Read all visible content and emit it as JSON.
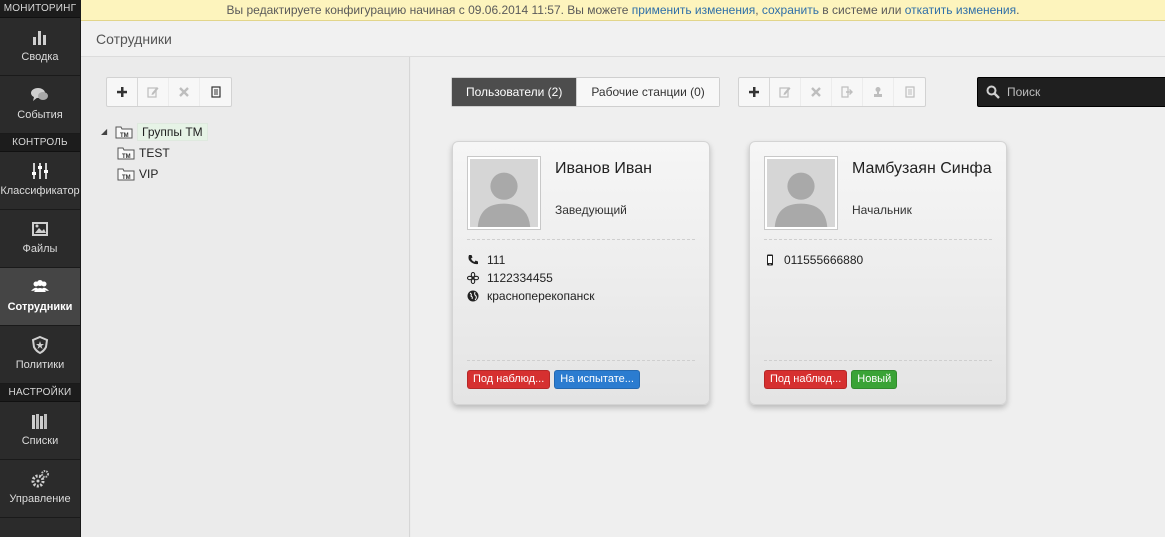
{
  "notice": {
    "text_before": "Вы редактируете конфигурацию начиная с 09.06.2014 11:57. Вы можете ",
    "apply_link": "применить изменения",
    "text_mid1": ", ",
    "save_link": "сохранить",
    "text_mid2": " в системе или ",
    "revert_link": "откатить изменения",
    "text_end": "."
  },
  "page_title": "Сотрудники",
  "nav": {
    "section_monitoring": "МОНИТОРИНГ",
    "section_control": "КОНТРОЛЬ",
    "section_settings": "НАСТРОЙКИ",
    "items": [
      {
        "label": "Сводка",
        "icon": "bar-chart-icon"
      },
      {
        "label": "События",
        "icon": "chat-bubbles-icon"
      },
      {
        "label": "Классификатор",
        "icon": "sliders-icon"
      },
      {
        "label": "Файлы",
        "icon": "images-icon"
      },
      {
        "label": "Сотрудники",
        "icon": "users-icon"
      },
      {
        "label": "Политики",
        "icon": "shield-star-icon"
      },
      {
        "label": "Списки",
        "icon": "books-icon"
      },
      {
        "label": "Управление",
        "icon": "gears-icon"
      }
    ]
  },
  "tree": {
    "root": "Группы ТМ",
    "children": [
      "TEST",
      "VIP"
    ]
  },
  "tabs": {
    "users": "Пользователи (2)",
    "workstations": "Рабочие станции (0)"
  },
  "search": {
    "placeholder": "Поиск"
  },
  "cards": [
    {
      "name": "Иванов Иван",
      "role": "Заведующий",
      "contacts": [
        {
          "type": "phone-icon",
          "value": "111"
        },
        {
          "type": "icq-flower-icon",
          "value": "1122334455"
        },
        {
          "type": "globe-icon",
          "value": "красноперекопанск"
        }
      ],
      "badges": [
        {
          "label": "Под наблюд...",
          "color": "#d63030"
        },
        {
          "label": "На испытате...",
          "color": "#2b7cd0"
        }
      ]
    },
    {
      "name": "Мамбузаян Синфа",
      "role": "Начальник",
      "contacts": [
        {
          "type": "mobile-phone-icon",
          "value": "011555666880"
        }
      ],
      "badges": [
        {
          "label": "Под наблюд...",
          "color": "#d63030"
        },
        {
          "label": "Новый",
          "color": "#3aa336"
        }
      ]
    }
  ],
  "colors": {
    "nav_bg": "#2b2b2b",
    "notice_bg": "#fdf4bd",
    "active_tab": "#4d4d4d",
    "link": "#2f6fa8"
  }
}
